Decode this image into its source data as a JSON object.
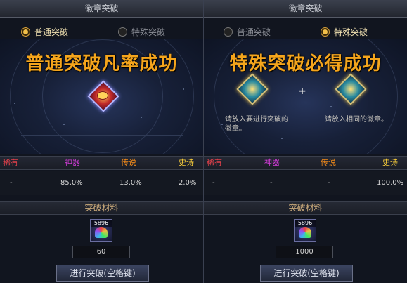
{
  "left": {
    "title": "徽章突破",
    "radio_normal": "普通突破",
    "radio_special": "特殊突破",
    "headline": "普通突破凡率成功",
    "rarity_headers": [
      "稀有",
      "神器",
      "传说",
      "史诗"
    ],
    "rarity_values": [
      "-",
      "85.0%",
      "13.0%",
      "2.0%"
    ],
    "materials_label": "突破材料",
    "material_count_badge": "5896",
    "quantity": "60",
    "button": "进行突破(空格键)"
  },
  "right": {
    "title": "徽章突破",
    "radio_normal": "普通突破",
    "radio_special": "特殊突破",
    "headline": "特殊突破必得成功",
    "hint_left": "请放入要进行突破的徽章。",
    "hint_right": "请放入相同的徽章。",
    "plus": "+",
    "rarity_headers": [
      "稀有",
      "神器",
      "传说",
      "史诗"
    ],
    "rarity_values": [
      "-",
      "-",
      "-",
      "100.0%"
    ],
    "materials_label": "突破材料",
    "material_count_badge": "5896",
    "quantity": "1000",
    "button": "进行突破(空格键)"
  },
  "colors": {
    "rare": "#e0404a",
    "artifact": "#d23bd8",
    "legend": "#f28a1a",
    "epic": "#ffd23a",
    "headline": "#f5a51c"
  },
  "icons": {
    "left_emblem": "red-eye-emblem-icon",
    "right_emblem_a": "teal-star-emblem-icon",
    "right_emblem_b": "teal-star-emblem-icon",
    "material": "rainbow-crystal-icon"
  }
}
